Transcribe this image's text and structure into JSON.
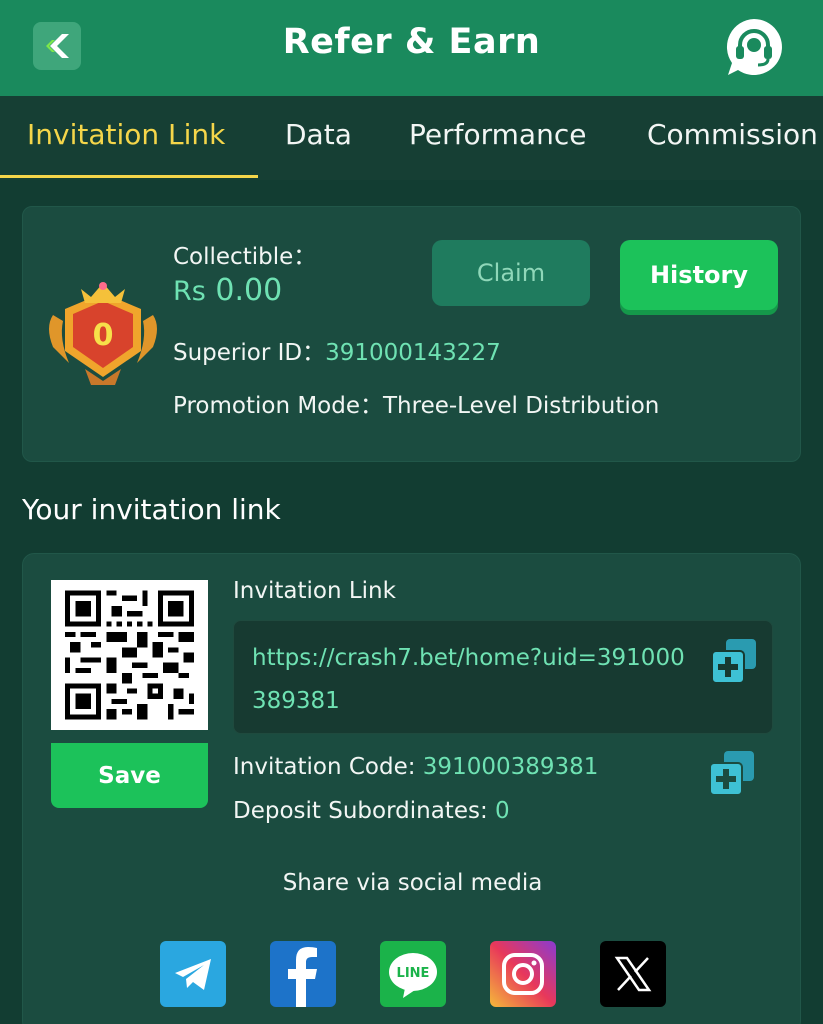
{
  "header": {
    "title": "Refer & Earn",
    "back_icon": "chevron-left-icon",
    "support_icon": "headset-icon"
  },
  "tabs": [
    {
      "label": "Invitation Link",
      "active": true
    },
    {
      "label": "Data",
      "active": false
    },
    {
      "label": "Performance",
      "active": false
    },
    {
      "label": "Commission",
      "active": false
    }
  ],
  "info": {
    "medal_level": "0",
    "collectible_label": "Collectible：",
    "currency": "Rs",
    "amount": "0.00",
    "claim_label": "Claim",
    "history_label": "History",
    "superior_label": "Superior ID：",
    "superior_id": "391000143227",
    "promotion_label": "Promotion Mode：",
    "promotion_value": "Three-Level Distribution"
  },
  "invite": {
    "section_title": "Your invitation link",
    "save_label": "Save",
    "link_label": "Invitation Link",
    "link_url": "https://crash7.bet/home?uid=391000389381",
    "code_label": "Invitation Code:",
    "code_value": "391000389381",
    "deposit_label": "Deposit Subordinates:",
    "deposit_value": "0",
    "share_title": "Share via social media",
    "socials": [
      "Telegram",
      "Facebook",
      "LINE",
      "Instagram",
      "X"
    ]
  },
  "colors": {
    "header_bg": "#1a8a5d",
    "page_bg": "#123d32",
    "card_bg": "#1b4c40",
    "accent_yellow": "#f5d64a",
    "accent_green": "#1cc25a",
    "value_green": "#6fe2b3"
  }
}
